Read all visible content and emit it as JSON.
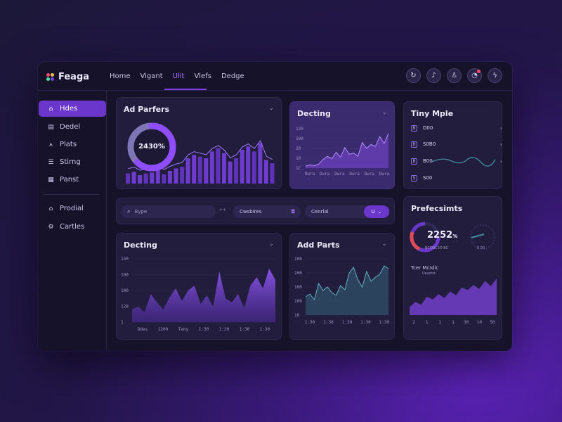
{
  "app": {
    "name": "Feaga"
  },
  "nav": {
    "items": [
      "Home",
      "Vigant",
      "Ulit",
      "Vlefs",
      "Dedge"
    ],
    "active_index": 2
  },
  "top_icons": [
    "refresh-icon",
    "music-note-icon",
    "user-icon",
    "chat-icon",
    "lightning-icon"
  ],
  "sidebar": {
    "items": [
      {
        "label": "Hdes",
        "icon": "home-icon",
        "glyph": "⌂",
        "active": true
      },
      {
        "label": "Dedel",
        "icon": "grid-icon",
        "glyph": "▤"
      },
      {
        "label": "Plats",
        "icon": "person-icon",
        "glyph": "⩚"
      },
      {
        "label": "Stirng",
        "icon": "stack-icon",
        "glyph": "☰"
      },
      {
        "label": "Panst",
        "icon": "table-icon",
        "glyph": "▦"
      },
      {
        "label": "Prodial",
        "icon": "house-icon",
        "glyph": "⌂"
      },
      {
        "label": "Cartles",
        "icon": "settings-icon",
        "glyph": "⚙"
      }
    ]
  },
  "card_ad_parters": {
    "title": "Ad Parfers",
    "donut_label": "2430%",
    "donut_value": 0.62
  },
  "card_decting_top": {
    "title": "Decting",
    "y_ticks": [
      "130",
      "100",
      "30",
      "10",
      "1C"
    ],
    "x_ticks": [
      "Dwra",
      "Dwra",
      "Dwra",
      "Dwra",
      "Dwra",
      "Dwra"
    ]
  },
  "card_tiny": {
    "title": "Tiny Mple",
    "rows": [
      {
        "badge": "B",
        "value": "D00"
      },
      {
        "badge": "B",
        "value": "S0B0"
      },
      {
        "badge": "B",
        "value": "B00"
      },
      {
        "badge": "S",
        "value": "S00"
      }
    ]
  },
  "filters": {
    "search_placeholder": "Bype",
    "sep": "++",
    "pill1": "Cwsbires",
    "pill2": "Cenrlal",
    "pill3": "U"
  },
  "card_decting_bottom": {
    "title": "Decting",
    "y_ticks": [
      "130",
      "100",
      "100",
      "128",
      "1"
    ],
    "x_ticks": [
      "Ddes",
      "1200",
      "Tany",
      "1:30",
      "1:30",
      "1:30",
      "1:30"
    ]
  },
  "card_add_parts": {
    "title": "Add Parts",
    "y_ticks": [
      "100",
      "100",
      "100",
      "100",
      "10"
    ],
    "x_ticks": [
      "1:30",
      "1:30",
      "1:30",
      "1:30",
      "1:30"
    ]
  },
  "card_pref": {
    "title": "Prefecsimts",
    "gauge_value": "2252",
    "gauge_unit": "%",
    "gauge_sub": "BCOBC3O BC",
    "small_gauge_sub": "0.00",
    "mini_title": "Tcer Mcrdic",
    "mini_sub": "Ueastst",
    "x_ticks": [
      "2",
      "1",
      "1",
      "1",
      "30",
      "10",
      "50"
    ]
  },
  "colors": {
    "accent": "#7b44e8",
    "accent_light": "#a673ff",
    "card_bg": "#221d3d",
    "window_bg": "#15122a",
    "teal": "#3f8d9a",
    "red": "#e04a55"
  },
  "chart_data": [
    {
      "type": "bar",
      "title": "Ad Parfers",
      "values": [
        12,
        14,
        10,
        12,
        13,
        16,
        11,
        15,
        18,
        20,
        30,
        34,
        32,
        30,
        38,
        42,
        36,
        26,
        30,
        40,
        44,
        38,
        48,
        28,
        24
      ]
    },
    {
      "type": "line",
      "title": "Decting",
      "values": [
        5,
        8,
        6,
        10,
        22,
        30,
        24,
        40,
        28,
        52,
        35,
        38,
        30,
        65,
        50,
        60,
        55,
        80,
        62,
        88
      ]
    },
    {
      "type": "area",
      "title": "Decting",
      "values": [
        18,
        22,
        14,
        40,
        28,
        18,
        35,
        48,
        30,
        45,
        52,
        26,
        38,
        22,
        72,
        34,
        28,
        40,
        20,
        52,
        64,
        48,
        76,
        60
      ]
    },
    {
      "type": "area",
      "title": "Add Parts",
      "values": [
        26,
        30,
        22,
        45,
        35,
        40,
        32,
        28,
        42,
        36,
        60,
        68,
        50,
        40,
        62,
        48,
        54,
        58,
        70,
        66
      ]
    },
    {
      "type": "area",
      "title": "Tcer Mcrdic",
      "values": [
        12,
        20,
        16,
        28,
        24,
        32,
        26,
        36,
        30,
        42,
        38,
        46,
        40,
        52,
        44,
        56
      ]
    }
  ]
}
